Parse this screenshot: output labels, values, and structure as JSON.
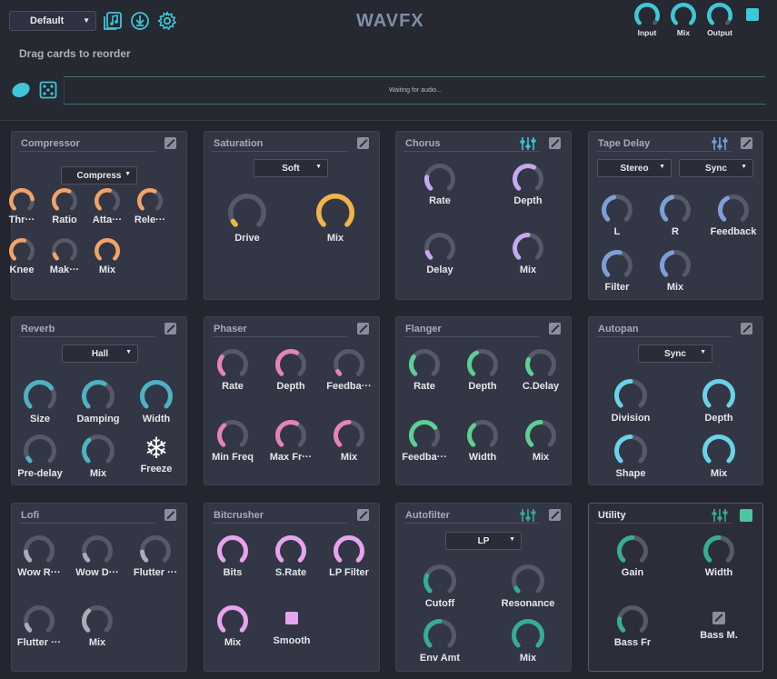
{
  "app": {
    "title": "WAVFX",
    "preset": "Default",
    "hint": "Drag cards to reorder",
    "status": "Waiting for audio..."
  },
  "colors": {
    "bg": "#24262f",
    "card": "#333644",
    "track": "#555a66",
    "cyan": "#3ec7d6",
    "orange": "#f0a36a",
    "yellow": "#f0b54a",
    "lavender": "#c6a8f0",
    "periwinkle": "#7d9fd8",
    "teal": "#4bb3c3",
    "pink": "#e684b6",
    "green": "#5ccf92",
    "grey": "#a9aeb8",
    "magenta": "#e6a4ef",
    "tealdark": "#36ad93",
    "sky": "#6ad2e8"
  },
  "io": [
    {
      "label": "Input",
      "value": 0.9
    },
    {
      "label": "Mix",
      "value": 1.0
    },
    {
      "label": "Output",
      "value": 0.9
    }
  ],
  "icons": [
    "music-file-icon",
    "download-icon",
    "gear-icon",
    "capsule-icon",
    "dice-icon"
  ],
  "cards": [
    {
      "id": "compressor",
      "title": "Compressor",
      "color": "orange",
      "dropdown": "Compress",
      "knobs": [
        {
          "label": "Thr···",
          "value": 0.8
        },
        {
          "label": "Ratio",
          "value": 0.6
        },
        {
          "label": "Atta···",
          "value": 0.55
        },
        {
          "label": "Rele···",
          "value": 0.6
        },
        {
          "label": "Knee",
          "value": 0.55
        },
        {
          "label": "Mak···",
          "value": 0.1
        },
        {
          "label": "Mix",
          "value": 1.0
        }
      ]
    },
    {
      "id": "saturation",
      "title": "Saturation",
      "color": "yellow",
      "dropdown": "Soft",
      "knobs": [
        {
          "label": "Drive",
          "value": 0.05
        },
        {
          "label": "Mix",
          "value": 1.0
        }
      ]
    },
    {
      "id": "chorus",
      "title": "Chorus",
      "color": "lavender",
      "eq": true,
      "knobs": [
        {
          "label": "Rate",
          "value": 0.2
        },
        {
          "label": "Depth",
          "value": 0.6
        },
        {
          "label": "Delay",
          "value": 0.1
        },
        {
          "label": "Mix",
          "value": 0.5
        }
      ]
    },
    {
      "id": "tape-delay",
      "title": "Tape Delay",
      "color": "periwinkle",
      "eq": true,
      "dropdowns": [
        "Stereo",
        "Sync"
      ],
      "knobs": [
        {
          "label": "L",
          "value": 0.45
        },
        {
          "label": "R",
          "value": 0.45
        },
        {
          "label": "Feedback",
          "value": 0.4
        },
        {
          "label": "Filter",
          "value": 0.55
        },
        {
          "label": "Mix",
          "value": 0.45
        }
      ]
    },
    {
      "id": "reverb",
      "title": "Reverb",
      "color": "teal",
      "dropdown": "Hall",
      "knobs": [
        {
          "label": "Size",
          "value": 0.7
        },
        {
          "label": "Damping",
          "value": 0.6
        },
        {
          "label": "Width",
          "value": 1.0
        },
        {
          "label": "Pre-delay",
          "value": 0.05
        },
        {
          "label": "Mix",
          "value": 0.35
        }
      ],
      "freeze": "Freeze"
    },
    {
      "id": "phaser",
      "title": "Phaser",
      "color": "pink",
      "knobs": [
        {
          "label": "Rate",
          "value": 0.3
        },
        {
          "label": "Depth",
          "value": 0.6
        },
        {
          "label": "Feedba···",
          "value": 0.05
        },
        {
          "label": "Min Freq",
          "value": 0.35
        },
        {
          "label": "Max Fr···",
          "value": 0.6
        },
        {
          "label": "Mix",
          "value": 0.5
        }
      ]
    },
    {
      "id": "flanger",
      "title": "Flanger",
      "color": "green",
      "knobs": [
        {
          "label": "Rate",
          "value": 0.3
        },
        {
          "label": "Depth",
          "value": 0.4
        },
        {
          "label": "C.Delay",
          "value": 0.25
        },
        {
          "label": "Feedba···",
          "value": 0.7
        },
        {
          "label": "Width",
          "value": 0.35
        },
        {
          "label": "Mix",
          "value": 0.5
        }
      ]
    },
    {
      "id": "autopan",
      "title": "Autopan",
      "color": "sky",
      "dropdown": "Sync",
      "knobs": [
        {
          "label": "Division",
          "value": 0.5
        },
        {
          "label": "Depth",
          "value": 1.0
        },
        {
          "label": "Shape",
          "value": 0.5
        },
        {
          "label": "Mix",
          "value": 1.0
        }
      ]
    },
    {
      "id": "lofi",
      "title": "Lofi",
      "color": "grey",
      "knobs": [
        {
          "label": "Wow R···",
          "value": 0.15
        },
        {
          "label": "Wow D···",
          "value": 0.1
        },
        {
          "label": "Flutter ···",
          "value": 0.15
        },
        {
          "label": "Flutter ···",
          "value": 0.1
        },
        {
          "label": "Mix",
          "value": 0.35
        }
      ]
    },
    {
      "id": "bitcrusher",
      "title": "Bitcrusher",
      "color": "magenta",
      "knobs": [
        {
          "label": "Bits",
          "value": 1.0
        },
        {
          "label": "S.Rate",
          "value": 1.0
        },
        {
          "label": "LP Filter",
          "value": 1.0
        },
        {
          "label": "Mix",
          "value": 1.0
        }
      ],
      "toggle": "Smooth"
    },
    {
      "id": "autofilter",
      "title": "Autofilter",
      "color": "tealdark",
      "eq": true,
      "dropdown": "LP",
      "knobs": [
        {
          "label": "Cutoff",
          "value": 0.25
        },
        {
          "label": "Resonance",
          "value": 0.05
        },
        {
          "label": "Env Amt",
          "value": 0.5
        },
        {
          "label": "Mix",
          "value": 1.0
        }
      ]
    },
    {
      "id": "utility",
      "title": "Utility",
      "color": "tealdark",
      "eq": true,
      "power": true,
      "knobs": [
        {
          "label": "Gain",
          "value": 0.5
        },
        {
          "label": "Width",
          "value": 0.5
        },
        {
          "label": "Bass Fr",
          "value": 0.2
        }
      ],
      "toggle": "Bass M."
    }
  ]
}
